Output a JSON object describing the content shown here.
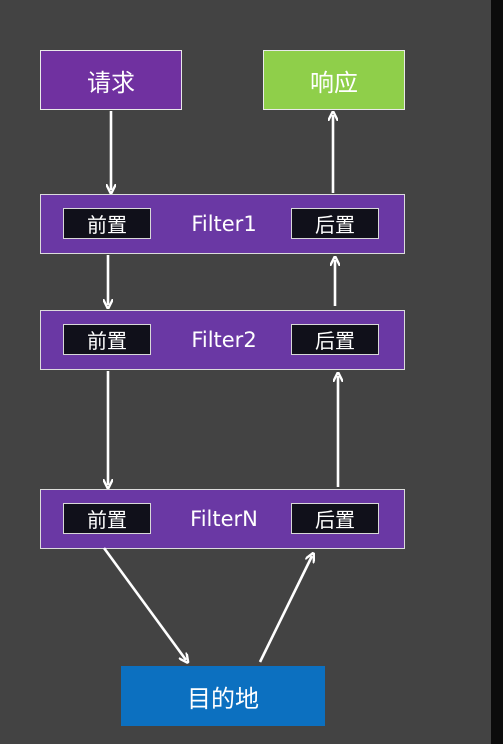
{
  "request": {
    "label": "请求"
  },
  "response": {
    "label": "响应"
  },
  "destination": {
    "label": "目的地"
  },
  "filters": [
    {
      "name": "Filter1",
      "pre_label": "前置",
      "post_label": "后置"
    },
    {
      "name": "Filter2",
      "pre_label": "前置",
      "post_label": "后置"
    },
    {
      "name": "FilterN",
      "pre_label": "前置",
      "post_label": "后置"
    }
  ],
  "colors": {
    "background": "#434343",
    "request": "#7031a0",
    "response": "#8fcf4a",
    "filter": "#6a38a4",
    "destination": "#0c70c0",
    "arrow": "#ffffff"
  }
}
